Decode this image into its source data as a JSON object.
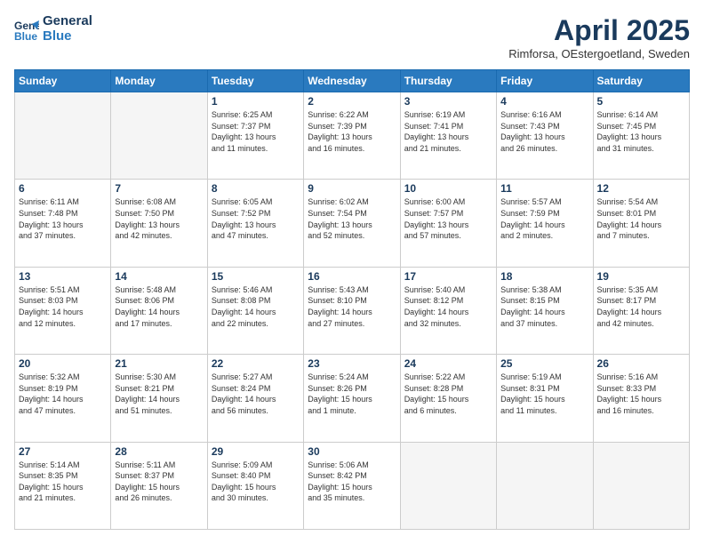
{
  "header": {
    "logo_line1": "General",
    "logo_line2": "Blue",
    "title": "April 2025",
    "location": "Rimforsa, OEstergoetland, Sweden"
  },
  "days_of_week": [
    "Sunday",
    "Monday",
    "Tuesday",
    "Wednesday",
    "Thursday",
    "Friday",
    "Saturday"
  ],
  "weeks": [
    [
      {
        "day": "",
        "text": ""
      },
      {
        "day": "",
        "text": ""
      },
      {
        "day": "1",
        "text": "Sunrise: 6:25 AM\nSunset: 7:37 PM\nDaylight: 13 hours\nand 11 minutes."
      },
      {
        "day": "2",
        "text": "Sunrise: 6:22 AM\nSunset: 7:39 PM\nDaylight: 13 hours\nand 16 minutes."
      },
      {
        "day": "3",
        "text": "Sunrise: 6:19 AM\nSunset: 7:41 PM\nDaylight: 13 hours\nand 21 minutes."
      },
      {
        "day": "4",
        "text": "Sunrise: 6:16 AM\nSunset: 7:43 PM\nDaylight: 13 hours\nand 26 minutes."
      },
      {
        "day": "5",
        "text": "Sunrise: 6:14 AM\nSunset: 7:45 PM\nDaylight: 13 hours\nand 31 minutes."
      }
    ],
    [
      {
        "day": "6",
        "text": "Sunrise: 6:11 AM\nSunset: 7:48 PM\nDaylight: 13 hours\nand 37 minutes."
      },
      {
        "day": "7",
        "text": "Sunrise: 6:08 AM\nSunset: 7:50 PM\nDaylight: 13 hours\nand 42 minutes."
      },
      {
        "day": "8",
        "text": "Sunrise: 6:05 AM\nSunset: 7:52 PM\nDaylight: 13 hours\nand 47 minutes."
      },
      {
        "day": "9",
        "text": "Sunrise: 6:02 AM\nSunset: 7:54 PM\nDaylight: 13 hours\nand 52 minutes."
      },
      {
        "day": "10",
        "text": "Sunrise: 6:00 AM\nSunset: 7:57 PM\nDaylight: 13 hours\nand 57 minutes."
      },
      {
        "day": "11",
        "text": "Sunrise: 5:57 AM\nSunset: 7:59 PM\nDaylight: 14 hours\nand 2 minutes."
      },
      {
        "day": "12",
        "text": "Sunrise: 5:54 AM\nSunset: 8:01 PM\nDaylight: 14 hours\nand 7 minutes."
      }
    ],
    [
      {
        "day": "13",
        "text": "Sunrise: 5:51 AM\nSunset: 8:03 PM\nDaylight: 14 hours\nand 12 minutes."
      },
      {
        "day": "14",
        "text": "Sunrise: 5:48 AM\nSunset: 8:06 PM\nDaylight: 14 hours\nand 17 minutes."
      },
      {
        "day": "15",
        "text": "Sunrise: 5:46 AM\nSunset: 8:08 PM\nDaylight: 14 hours\nand 22 minutes."
      },
      {
        "day": "16",
        "text": "Sunrise: 5:43 AM\nSunset: 8:10 PM\nDaylight: 14 hours\nand 27 minutes."
      },
      {
        "day": "17",
        "text": "Sunrise: 5:40 AM\nSunset: 8:12 PM\nDaylight: 14 hours\nand 32 minutes."
      },
      {
        "day": "18",
        "text": "Sunrise: 5:38 AM\nSunset: 8:15 PM\nDaylight: 14 hours\nand 37 minutes."
      },
      {
        "day": "19",
        "text": "Sunrise: 5:35 AM\nSunset: 8:17 PM\nDaylight: 14 hours\nand 42 minutes."
      }
    ],
    [
      {
        "day": "20",
        "text": "Sunrise: 5:32 AM\nSunset: 8:19 PM\nDaylight: 14 hours\nand 47 minutes."
      },
      {
        "day": "21",
        "text": "Sunrise: 5:30 AM\nSunset: 8:21 PM\nDaylight: 14 hours\nand 51 minutes."
      },
      {
        "day": "22",
        "text": "Sunrise: 5:27 AM\nSunset: 8:24 PM\nDaylight: 14 hours\nand 56 minutes."
      },
      {
        "day": "23",
        "text": "Sunrise: 5:24 AM\nSunset: 8:26 PM\nDaylight: 15 hours\nand 1 minute."
      },
      {
        "day": "24",
        "text": "Sunrise: 5:22 AM\nSunset: 8:28 PM\nDaylight: 15 hours\nand 6 minutes."
      },
      {
        "day": "25",
        "text": "Sunrise: 5:19 AM\nSunset: 8:31 PM\nDaylight: 15 hours\nand 11 minutes."
      },
      {
        "day": "26",
        "text": "Sunrise: 5:16 AM\nSunset: 8:33 PM\nDaylight: 15 hours\nand 16 minutes."
      }
    ],
    [
      {
        "day": "27",
        "text": "Sunrise: 5:14 AM\nSunset: 8:35 PM\nDaylight: 15 hours\nand 21 minutes."
      },
      {
        "day": "28",
        "text": "Sunrise: 5:11 AM\nSunset: 8:37 PM\nDaylight: 15 hours\nand 26 minutes."
      },
      {
        "day": "29",
        "text": "Sunrise: 5:09 AM\nSunset: 8:40 PM\nDaylight: 15 hours\nand 30 minutes."
      },
      {
        "day": "30",
        "text": "Sunrise: 5:06 AM\nSunset: 8:42 PM\nDaylight: 15 hours\nand 35 minutes."
      },
      {
        "day": "",
        "text": ""
      },
      {
        "day": "",
        "text": ""
      },
      {
        "day": "",
        "text": ""
      }
    ]
  ]
}
